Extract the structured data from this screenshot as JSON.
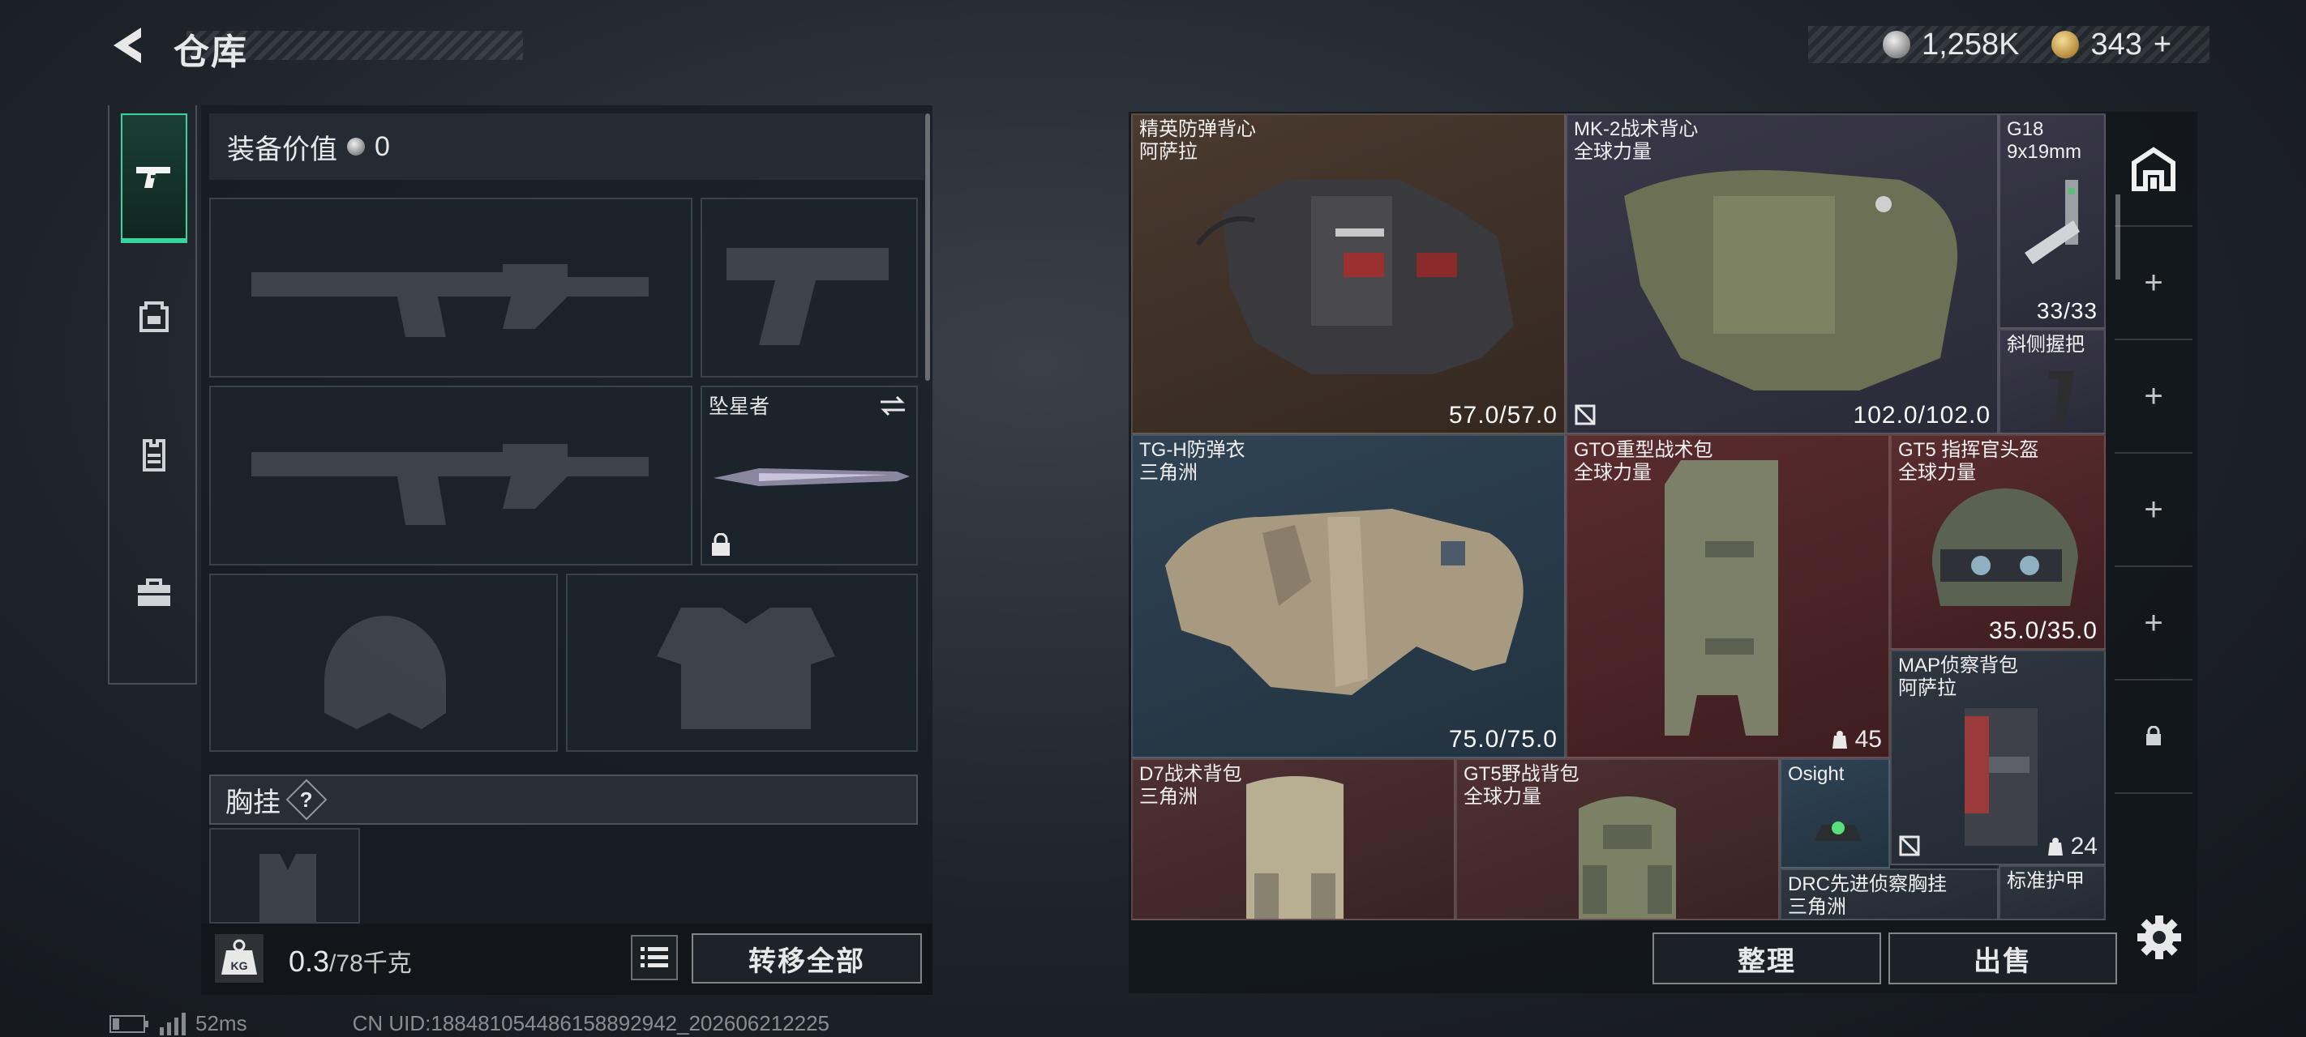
{
  "header": {
    "title": "仓库"
  },
  "currency": {
    "coins": "1,258K",
    "premium": "343",
    "premium_add": "+"
  },
  "equipment": {
    "value_label": "装备价值",
    "value": "0",
    "melee_name": "坠星者",
    "chest_rig_label": "胸挂",
    "chest_rig_help": "?",
    "weight_current": "0.3",
    "weight_max": "/78千克",
    "weight_icon_text": "KG",
    "transfer_all_label": "转移全部"
  },
  "warehouse": {
    "items": [
      {
        "name": "精英防弹背心\n阿萨拉",
        "durability": "57.0/57.0",
        "color": "#4a3a30"
      },
      {
        "name": "MK-2战术背心\n全球力量",
        "durability": "102.0/102.0",
        "color": "#3a3848"
      },
      {
        "name": "G18\n9x19mm",
        "ammo": "33/33",
        "color": "#3a3848"
      },
      {
        "name": "斜侧握把",
        "color": "#3a3848"
      },
      {
        "name": "TG-H防弹衣\n三角洲",
        "durability": "75.0/75.0",
        "color": "#2f4354"
      },
      {
        "name": "GTO重型战术包\n全球力量",
        "capacity": "45",
        "color": "#5a2c2e"
      },
      {
        "name": "GT5 指挥官头盔\n全球力量",
        "durability": "35.0/35.0",
        "color": "#5a2c2e"
      },
      {
        "name": "MAP侦察背包\n阿萨拉",
        "capacity": "24",
        "color": "#2e3640"
      },
      {
        "name": "D7战术背包\n三角洲",
        "color": "#4e3033"
      },
      {
        "name": "GT5野战背包\n全球力量",
        "color": "#4e3033"
      },
      {
        "name": "Osight",
        "color": "#2f4354"
      },
      {
        "name": "DRC先进侦察胸挂\n三角洲",
        "color": "#2e3640"
      },
      {
        "name": "标准护甲",
        "color": "#2e3640"
      }
    ],
    "sort_label": "整理",
    "sell_label": "出售"
  },
  "status": {
    "ping": "52ms",
    "uid": "CN UID:18848105448615889294​2_202606212225"
  },
  "icons": [
    "back-arrow-icon",
    "pistol-icon",
    "backpack-icon",
    "vest-icon",
    "toolbox-icon",
    "weight-icon",
    "list-icon",
    "swap-icon",
    "lock-icon",
    "settings-icon",
    "warehouse-icon",
    "plus-icon",
    "no-repair-icon",
    "capacity-icon",
    "battery-icon",
    "signal-icon"
  ]
}
